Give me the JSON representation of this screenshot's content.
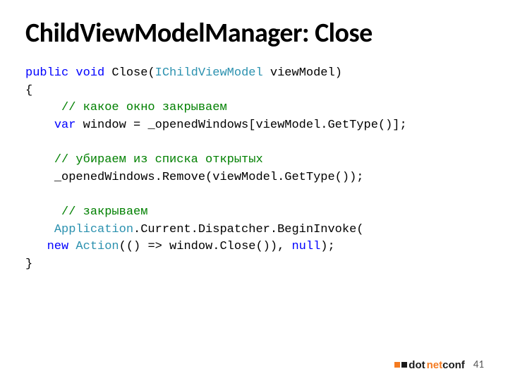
{
  "title": "ChildViewModelManager: Close",
  "code": {
    "l1": {
      "kw1": "public",
      "sp1": " ",
      "kw2": "void",
      "sp2": " Close(",
      "type1": "IChildViewModel",
      "rest": " viewModel)"
    },
    "l2": "{",
    "l3": {
      "pad": "     ",
      "cm": "// какое окно закрываем"
    },
    "l4": {
      "pad": "    ",
      "kw": "var",
      "rest": " window = _openedWindows[viewModel.GetType()];"
    },
    "l5": "",
    "l6": {
      "pad": "    ",
      "cm": "// убираем из списка открытых"
    },
    "l7": {
      "pad": "    ",
      "rest": "_openedWindows.Remove(viewModel.GetType());"
    },
    "l8": "",
    "l9": {
      "pad": "     ",
      "cm": "// закрываем"
    },
    "l10": {
      "pad": "    ",
      "type": "Application",
      "rest": ".Current.Dispatcher.BeginInvoke("
    },
    "l11": {
      "pad": "   ",
      "kw1": "new",
      "sp1": " ",
      "type": "Action",
      "rest1": "(() => window.Close()), ",
      "kw2": "null",
      "rest2": ");"
    },
    "l12": "}"
  },
  "footer": {
    "logo_prefix": "dot",
    "logo_suffix": "net",
    "logo_tail": "conf",
    "page": "41"
  },
  "colors": {
    "keyword": "#0000ff",
    "type": "#2b91af",
    "comment": "#008000",
    "accent": "#f47a20"
  }
}
